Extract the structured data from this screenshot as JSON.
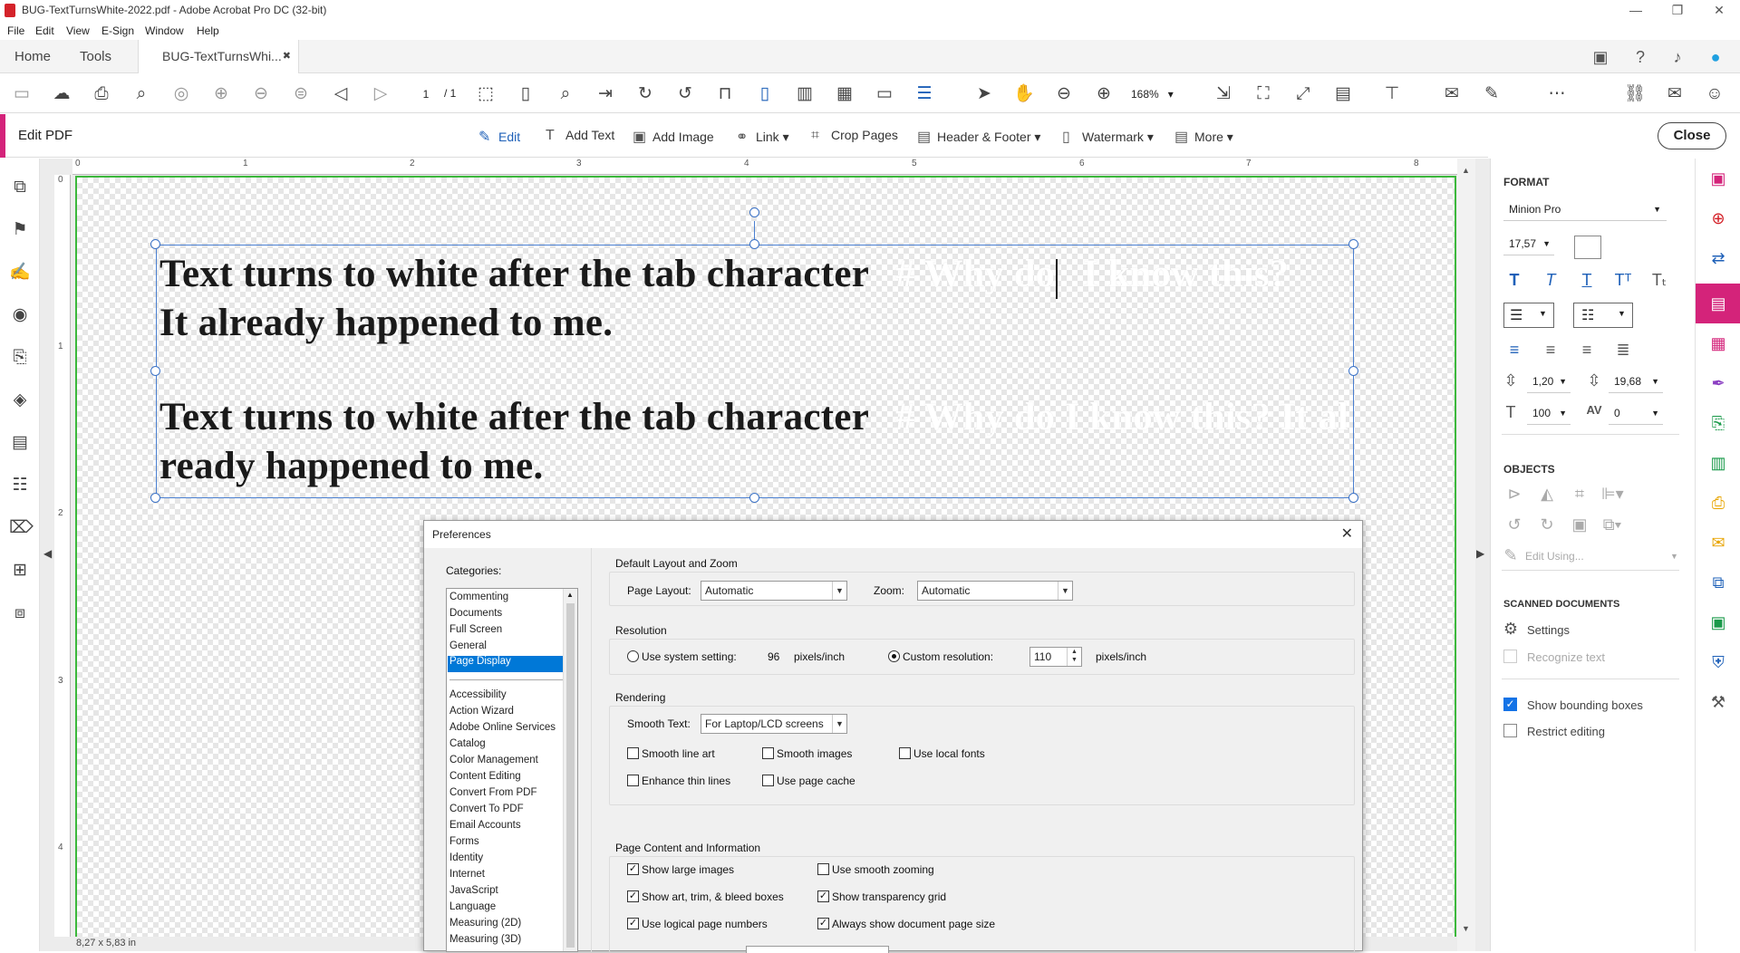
{
  "window": {
    "title": "BUG-TextTurnsWhite-2022.pdf - Adobe Acrobat Pro DC (32-bit)",
    "controls": [
      "—",
      "❐",
      "✕"
    ]
  },
  "menu": [
    "File",
    "Edit",
    "View",
    "E-Sign",
    "Window",
    "Help"
  ],
  "tabs": {
    "home": "Home",
    "tools": "Tools",
    "doc": "BUG-TextTurnsWhi...",
    "doc_close": "✖"
  },
  "toolbar": {
    "page_current": "1",
    "page_total": "/ 1",
    "zoom": "168%"
  },
  "editbar": {
    "label": "Edit PDF",
    "items": [
      "Edit",
      "Add Text",
      "Add Image",
      "Link ▾",
      "Crop Pages",
      "Header & Footer ▾",
      "Watermark ▾",
      "More ▾"
    ],
    "close": "Close"
  },
  "ruler": {
    "h": [
      "0",
      "1",
      "2",
      "3",
      "4",
      "5",
      "6",
      "7",
      "8"
    ],
    "v": [
      "0",
      "1",
      "2",
      "3",
      "4"
    ]
  },
  "document": {
    "para1_line1": "Text turns to white after the tab character",
    "para1_line1_white_a": "# Why do",
    "para1_line1_white_b": "I know this?",
    "para1_line2": "It already happened to me.",
    "para2_line1": "Text turns to white after the tab character",
    "para2_line1_white": "# Why do I know this? It al",
    "para2_line2": "ready happened to me."
  },
  "status": {
    "page_size": "8,27 x 5,83 in"
  },
  "format_panel": {
    "format_heading": "FORMAT",
    "font": "Minion Pro",
    "font_size": "17,57",
    "line_spacing": "1,20",
    "para_spacing": "19,68",
    "h_scale": "100",
    "char_spacing": "0",
    "objects_heading": "OBJECTS",
    "edit_using": "Edit Using...",
    "scanned_heading": "SCANNED DOCUMENTS",
    "settings": "Settings",
    "recognize": "Recognize text",
    "show_bounding": "Show bounding boxes",
    "restrict": "Restrict editing"
  },
  "preferences": {
    "title": "Preferences",
    "categories_label": "Categories:",
    "categories_top": [
      "Commenting",
      "Documents",
      "Full Screen",
      "General",
      "Page Display"
    ],
    "categories": [
      "Accessibility",
      "Action Wizard",
      "Adobe Online Services",
      "Catalog",
      "Color Management",
      "Content Editing",
      "Convert From PDF",
      "Convert To PDF",
      "Email Accounts",
      "Forms",
      "Identity",
      "Internet",
      "JavaScript",
      "Language",
      "Measuring (2D)",
      "Measuring (3D)"
    ],
    "layout_group": "Default Layout and Zoom",
    "page_layout_label": "Page Layout:",
    "page_layout": "Automatic",
    "zoom_label": "Zoom:",
    "zoom": "Automatic",
    "resolution_group": "Resolution",
    "use_system": "Use system setting:",
    "system_value": "96",
    "ppi1": "pixels/inch",
    "custom_res": "Custom resolution:",
    "custom_value": "110",
    "ppi2": "pixels/inch",
    "rendering_group": "Rendering",
    "smooth_text_label": "Smooth Text:",
    "smooth_text": "For Laptop/LCD screens",
    "smooth_line_art": "Smooth line art",
    "smooth_images": "Smooth images",
    "use_local_fonts": "Use local fonts",
    "enhance_thin": "Enhance thin lines",
    "use_page_cache": "Use page cache",
    "content_group": "Page Content and Information",
    "show_large_images": "Show large images",
    "use_smooth_zoom": "Use smooth zooming",
    "show_art_trim": "Show art, trim, & bleed boxes",
    "show_transparency": "Show transparency grid",
    "use_logical": "Use logical page numbers",
    "always_show_size": "Always show document page size"
  }
}
